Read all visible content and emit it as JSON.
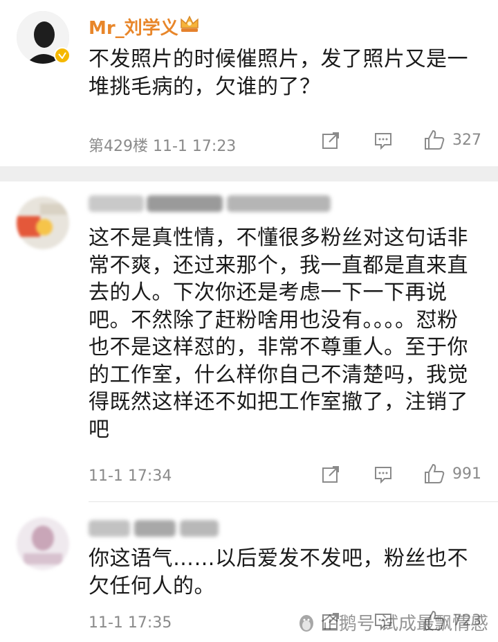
{
  "comments": [
    {
      "username": "Mr_刘学义",
      "content": "不发照片的时候催照片，发了照片又是一堆挑毛病的，欠谁的了？",
      "meta": "第429楼  11-1 17:23",
      "likes": "327"
    },
    {
      "username": "",
      "content": "这不是真性情，不懂很多粉丝对这句话非常不爽，还过来那个，我一直都是直来直去的人。下次你还是考虑一下一下再说吧。不然除了赶粉啥用也没有。。。。怼粉也不是这样怼的，非常不尊重人。至于你的工作室，什么样你自己不清楚吗，我觉得既然这样还不如把工作室撤了，注销了吧",
      "meta": "11-1 17:34",
      "likes": "991"
    },
    {
      "username": "",
      "content": "你这语气……以后爱发不发吧，粉丝也不欠任何人的。",
      "meta": "11-1 17:35",
      "likes": "723"
    }
  ],
  "watermark": {
    "text": "企鹅号 试成最飘情感"
  },
  "colors": {
    "username": "#e8862a",
    "meta": "#8a8a8a",
    "divider": "#eeeeee",
    "verified_badge": "#f5b800"
  },
  "icons": [
    "crown-icon",
    "verified-badge-icon",
    "share-icon",
    "comment-icon",
    "like-icon"
  ]
}
